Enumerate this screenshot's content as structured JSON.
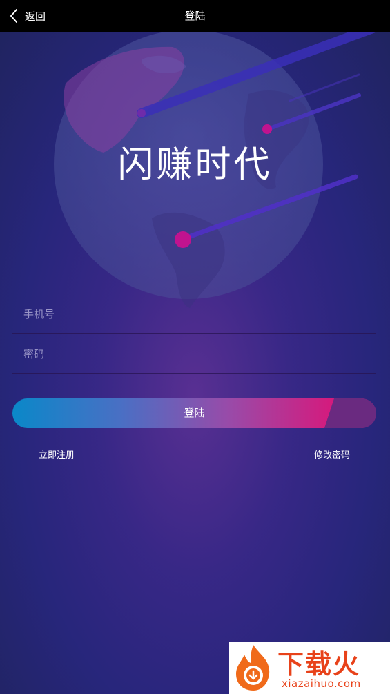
{
  "nav": {
    "back_label": "返回",
    "title": "登陆"
  },
  "hero": {
    "brand_text": "闪赚时代"
  },
  "form": {
    "phone_placeholder": "手机号",
    "phone_value": "",
    "password_placeholder": "密码",
    "password_value": "",
    "login_label": "登陆",
    "register_label": "立即注册",
    "change_password_label": "修改密码"
  },
  "watermark": {
    "main": "下载火",
    "sub": "xiazaihuo.com"
  },
  "colors": {
    "nav_bg": "#000000",
    "button_start": "#0a88c9",
    "button_end": "#d9177a",
    "watermark": "#e8421a"
  }
}
